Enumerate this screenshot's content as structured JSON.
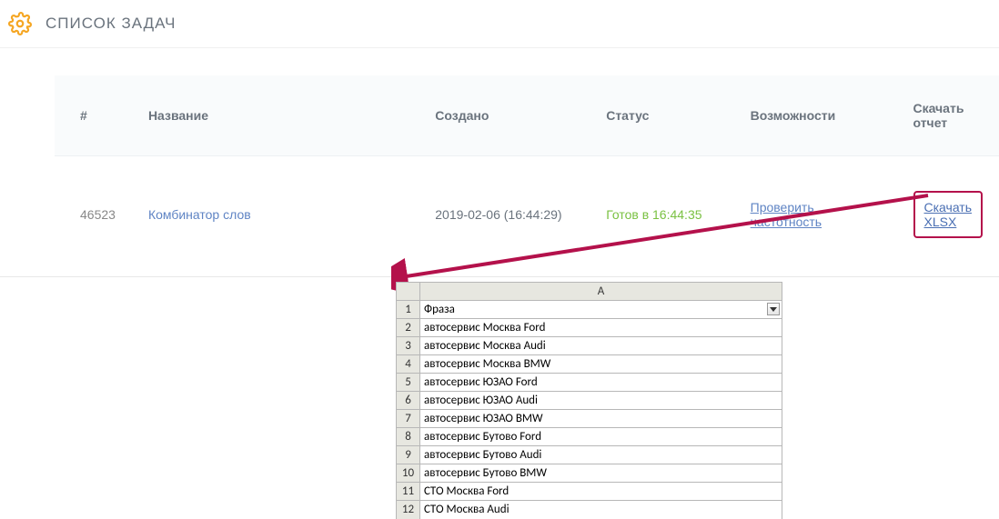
{
  "header": {
    "title": "СПИСОК ЗАДАЧ"
  },
  "tasks": {
    "columns": {
      "num": "#",
      "name": "Название",
      "created": "Создано",
      "status": "Статус",
      "options": "Возможности",
      "download": "Скачать отчет"
    },
    "row": {
      "id": "46523",
      "name": "Комбинатор слов",
      "created": "2019-02-06 (16:44:29)",
      "status": "Готов в 16:44:35",
      "option_link": "Проверить частотность",
      "download_link": "Скачать XLSX"
    }
  },
  "sheet": {
    "col_label": "A",
    "rows": [
      {
        "n": "1",
        "val": "Фраза"
      },
      {
        "n": "2",
        "val": "автосервис Москва Ford"
      },
      {
        "n": "3",
        "val": "автосервис Москва Audi"
      },
      {
        "n": "4",
        "val": "автосервис Москва BMW"
      },
      {
        "n": "5",
        "val": "автосервис ЮЗАО Ford"
      },
      {
        "n": "6",
        "val": "автосервис ЮЗАО Audi"
      },
      {
        "n": "7",
        "val": "автосервис ЮЗАО BMW"
      },
      {
        "n": "8",
        "val": "автосервис Бутово Ford"
      },
      {
        "n": "9",
        "val": "автосервис Бутово Audi"
      },
      {
        "n": "10",
        "val": "автосервис Бутово BMW"
      },
      {
        "n": "11",
        "val": "СТО Москва Ford"
      },
      {
        "n": "12",
        "val": "СТО Москва Audi"
      }
    ]
  }
}
